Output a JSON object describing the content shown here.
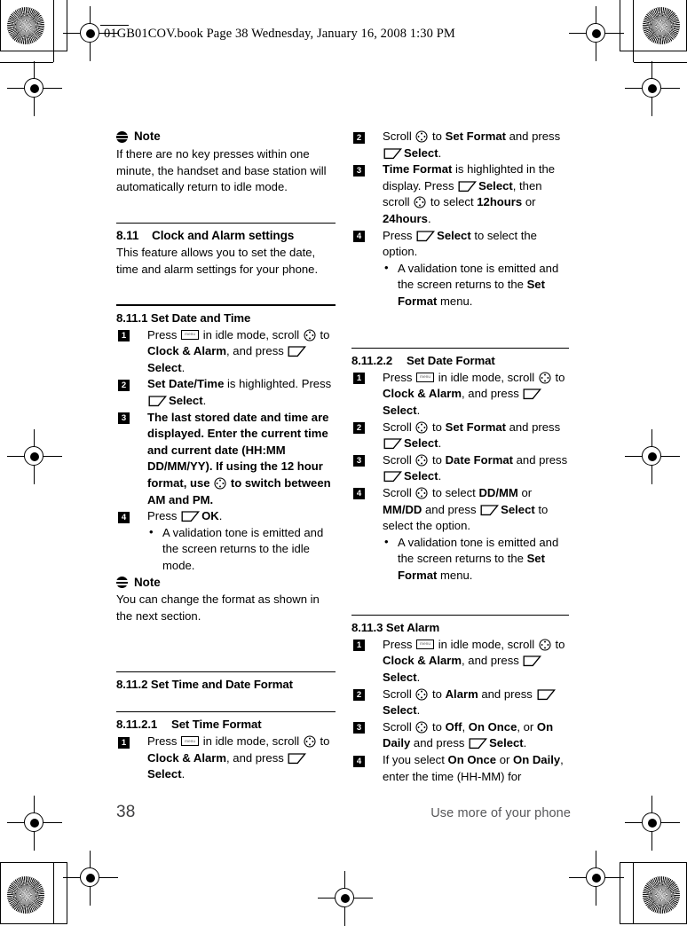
{
  "page": {
    "file_stamp": "01GB01COV.book   Page 38   Wednesday, January 16, 2008   1:30 PM",
    "page_number": "38",
    "running_head": "Use more of your phone"
  },
  "icons": {
    "note": "note-icon",
    "menu_key": "menu-key-icon",
    "scroll_key": "scroll-navigation-icon",
    "soft_key": "soft-key-select-icon"
  },
  "left_column": {
    "note_1": {
      "title": "Note",
      "body": "If there are no key presses within one minute, the handset and base station will automatically return to idle mode."
    },
    "section_811": {
      "number": "8.11",
      "title": "Clock and Alarm settings",
      "intro": "This feature allows you to set the date, time and alarm settings for your phone."
    },
    "section_8111": {
      "heading": "8.11.1 Set Date and Time",
      "steps": [
        {
          "n": "1",
          "parts": [
            {
              "t": "text",
              "v": "Press "
            },
            {
              "t": "icon",
              "v": "menu_key"
            },
            {
              "t": "text",
              "v": " in idle mode, scroll "
            },
            {
              "t": "icon",
              "v": "scroll_key"
            },
            {
              "t": "text",
              "v": " to "
            },
            {
              "t": "bold",
              "v": "Clock & Alarm"
            },
            {
              "t": "text",
              "v": ", and press "
            },
            {
              "t": "icon",
              "v": "soft_key"
            },
            {
              "t": "bold",
              "v": "Select"
            },
            {
              "t": "text",
              "v": "."
            }
          ]
        },
        {
          "n": "2",
          "parts": [
            {
              "t": "bold",
              "v": "Set Date/Time"
            },
            {
              "t": "text",
              "v": " is highlighted. Press "
            },
            {
              "t": "icon",
              "v": "soft_key"
            },
            {
              "t": "bold",
              "v": "Select"
            },
            {
              "t": "text",
              "v": "."
            }
          ]
        },
        {
          "n": "3",
          "parts": [
            {
              "t": "semi",
              "v": "The last stored date and time are displayed. Enter the current time and current date (HH:MM DD/MM/YY). If using the 12 hour format, use "
            },
            {
              "t": "icon",
              "v": "scroll_key"
            },
            {
              "t": "semi",
              "v": " to switch between AM and PM."
            }
          ]
        },
        {
          "n": "4",
          "parts": [
            {
              "t": "text",
              "v": "Press "
            },
            {
              "t": "icon",
              "v": "soft_key"
            },
            {
              "t": "bold",
              "v": "OK"
            },
            {
              "t": "text",
              "v": "."
            }
          ],
          "bullets": [
            [
              {
                "t": "text",
                "v": "A validation tone is emitted and the screen returns to the idle mode."
              }
            ]
          ]
        }
      ]
    },
    "note_2": {
      "title": "Note",
      "body": "You can change the format as shown in the next section."
    },
    "section_8112": {
      "heading": "8.11.2 Set Time and Date Format"
    },
    "section_81121": {
      "number": "8.11.2.1",
      "title": "Set Time Format",
      "steps": [
        {
          "n": "1",
          "parts": [
            {
              "t": "text",
              "v": "Press "
            },
            {
              "t": "icon",
              "v": "menu_key"
            },
            {
              "t": "text",
              "v": " in idle mode, scroll "
            },
            {
              "t": "icon",
              "v": "scroll_key"
            },
            {
              "t": "text",
              "v": " to "
            },
            {
              "t": "bold",
              "v": "Clock & Alarm"
            },
            {
              "t": "text",
              "v": ", and press "
            },
            {
              "t": "icon",
              "v": "soft_key"
            },
            {
              "t": "bold",
              "v": "Select"
            },
            {
              "t": "text",
              "v": "."
            }
          ]
        }
      ]
    }
  },
  "right_column": {
    "section_81121_cont": {
      "steps": [
        {
          "n": "2",
          "parts": [
            {
              "t": "text",
              "v": "Scroll "
            },
            {
              "t": "icon",
              "v": "scroll_key"
            },
            {
              "t": "text",
              "v": " to "
            },
            {
              "t": "bold",
              "v": "Set Format"
            },
            {
              "t": "text",
              "v": " and press "
            },
            {
              "t": "icon",
              "v": "soft_key"
            },
            {
              "t": "bold",
              "v": "Select"
            },
            {
              "t": "text",
              "v": "."
            }
          ]
        },
        {
          "n": "3",
          "parts": [
            {
              "t": "bold",
              "v": "Time Format"
            },
            {
              "t": "text",
              "v": " is highlighted in the display. Press "
            },
            {
              "t": "icon",
              "v": "soft_key"
            },
            {
              "t": "bold",
              "v": "Select"
            },
            {
              "t": "text",
              "v": ", then scroll "
            },
            {
              "t": "icon",
              "v": "scroll_key"
            },
            {
              "t": "text",
              "v": " to select "
            },
            {
              "t": "bold",
              "v": "12hours"
            },
            {
              "t": "text",
              "v": " or "
            },
            {
              "t": "bold",
              "v": "24hours"
            },
            {
              "t": "text",
              "v": "."
            }
          ]
        },
        {
          "n": "4",
          "parts": [
            {
              "t": "text",
              "v": "Press "
            },
            {
              "t": "icon",
              "v": "soft_key"
            },
            {
              "t": "bold",
              "v": "Select"
            },
            {
              "t": "text",
              "v": " to select the option."
            }
          ],
          "bullets": [
            [
              {
                "t": "text",
                "v": "A validation tone is emitted and the screen returns to the "
              },
              {
                "t": "bold",
                "v": "Set Format"
              },
              {
                "t": "text",
                "v": " menu."
              }
            ]
          ]
        }
      ]
    },
    "section_81122": {
      "number": "8.11.2.2",
      "title": "Set Date Format",
      "steps": [
        {
          "n": "1",
          "parts": [
            {
              "t": "text",
              "v": "Press "
            },
            {
              "t": "icon",
              "v": "menu_key"
            },
            {
              "t": "text",
              "v": " in idle mode, scroll "
            },
            {
              "t": "icon",
              "v": "scroll_key"
            },
            {
              "t": "text",
              "v": " to "
            },
            {
              "t": "bold",
              "v": "Clock & Alarm"
            },
            {
              "t": "text",
              "v": ", and press "
            },
            {
              "t": "icon",
              "v": "soft_key"
            },
            {
              "t": "bold",
              "v": "Select"
            },
            {
              "t": "text",
              "v": "."
            }
          ]
        },
        {
          "n": "2",
          "parts": [
            {
              "t": "text",
              "v": "Scroll "
            },
            {
              "t": "icon",
              "v": "scroll_key"
            },
            {
              "t": "text",
              "v": " to "
            },
            {
              "t": "bold",
              "v": "Set Format"
            },
            {
              "t": "text",
              "v": " and press "
            },
            {
              "t": "icon",
              "v": "soft_key"
            },
            {
              "t": "bold",
              "v": "Select"
            },
            {
              "t": "text",
              "v": "."
            }
          ]
        },
        {
          "n": "3",
          "parts": [
            {
              "t": "text",
              "v": "Scroll "
            },
            {
              "t": "icon",
              "v": "scroll_key"
            },
            {
              "t": "text",
              "v": " to "
            },
            {
              "t": "bold",
              "v": "Date Format"
            },
            {
              "t": "text",
              "v": " and press "
            },
            {
              "t": "icon",
              "v": "soft_key"
            },
            {
              "t": "bold",
              "v": "Select"
            },
            {
              "t": "text",
              "v": "."
            }
          ]
        },
        {
          "n": "4",
          "parts": [
            {
              "t": "text",
              "v": "Scroll "
            },
            {
              "t": "icon",
              "v": "scroll_key"
            },
            {
              "t": "text",
              "v": " to select "
            },
            {
              "t": "bold",
              "v": "DD/MM"
            },
            {
              "t": "text",
              "v": " or "
            },
            {
              "t": "bold",
              "v": "MM/DD"
            },
            {
              "t": "text",
              "v": " and press "
            },
            {
              "t": "icon",
              "v": "soft_key"
            },
            {
              "t": "bold",
              "v": "Select"
            },
            {
              "t": "text",
              "v": " to select the option."
            }
          ],
          "bullets": [
            [
              {
                "t": "text",
                "v": "A validation tone is emitted and the screen returns to the "
              },
              {
                "t": "bold",
                "v": "Set Format"
              },
              {
                "t": "text",
                "v": " menu."
              }
            ]
          ]
        }
      ]
    },
    "section_8113": {
      "heading": "8.11.3 Set Alarm",
      "steps": [
        {
          "n": "1",
          "parts": [
            {
              "t": "text",
              "v": "Press "
            },
            {
              "t": "icon",
              "v": "menu_key"
            },
            {
              "t": "text",
              "v": " in idle mode, scroll "
            },
            {
              "t": "icon",
              "v": "scroll_key"
            },
            {
              "t": "text",
              "v": " to "
            },
            {
              "t": "bold",
              "v": "Clock & Alarm"
            },
            {
              "t": "text",
              "v": ", and press "
            },
            {
              "t": "icon",
              "v": "soft_key"
            },
            {
              "t": "bold",
              "v": "Select"
            },
            {
              "t": "text",
              "v": "."
            }
          ]
        },
        {
          "n": "2",
          "parts": [
            {
              "t": "text",
              "v": "Scroll "
            },
            {
              "t": "icon",
              "v": "scroll_key"
            },
            {
              "t": "text",
              "v": " to "
            },
            {
              "t": "bold",
              "v": "Alarm"
            },
            {
              "t": "text",
              "v": " and press "
            },
            {
              "t": "icon",
              "v": "soft_key"
            },
            {
              "t": "bold",
              "v": "Select"
            },
            {
              "t": "text",
              "v": "."
            }
          ]
        },
        {
          "n": "3",
          "parts": [
            {
              "t": "text",
              "v": "Scroll "
            },
            {
              "t": "icon",
              "v": "scroll_key"
            },
            {
              "t": "text",
              "v": " to "
            },
            {
              "t": "bold",
              "v": "Off"
            },
            {
              "t": "text",
              "v": ", "
            },
            {
              "t": "bold",
              "v": "On Once"
            },
            {
              "t": "text",
              "v": ", or "
            },
            {
              "t": "bold",
              "v": "On Daily"
            },
            {
              "t": "text",
              "v": " and press "
            },
            {
              "t": "icon",
              "v": "soft_key"
            },
            {
              "t": "bold",
              "v": "Select"
            },
            {
              "t": "text",
              "v": "."
            }
          ]
        },
        {
          "n": "4",
          "parts": [
            {
              "t": "text",
              "v": "If you select "
            },
            {
              "t": "bold",
              "v": "On Once"
            },
            {
              "t": "text",
              "v": " or "
            },
            {
              "t": "bold",
              "v": "On Daily"
            },
            {
              "t": "text",
              "v": ", enter the time (HH-MM) for"
            }
          ]
        }
      ]
    }
  }
}
